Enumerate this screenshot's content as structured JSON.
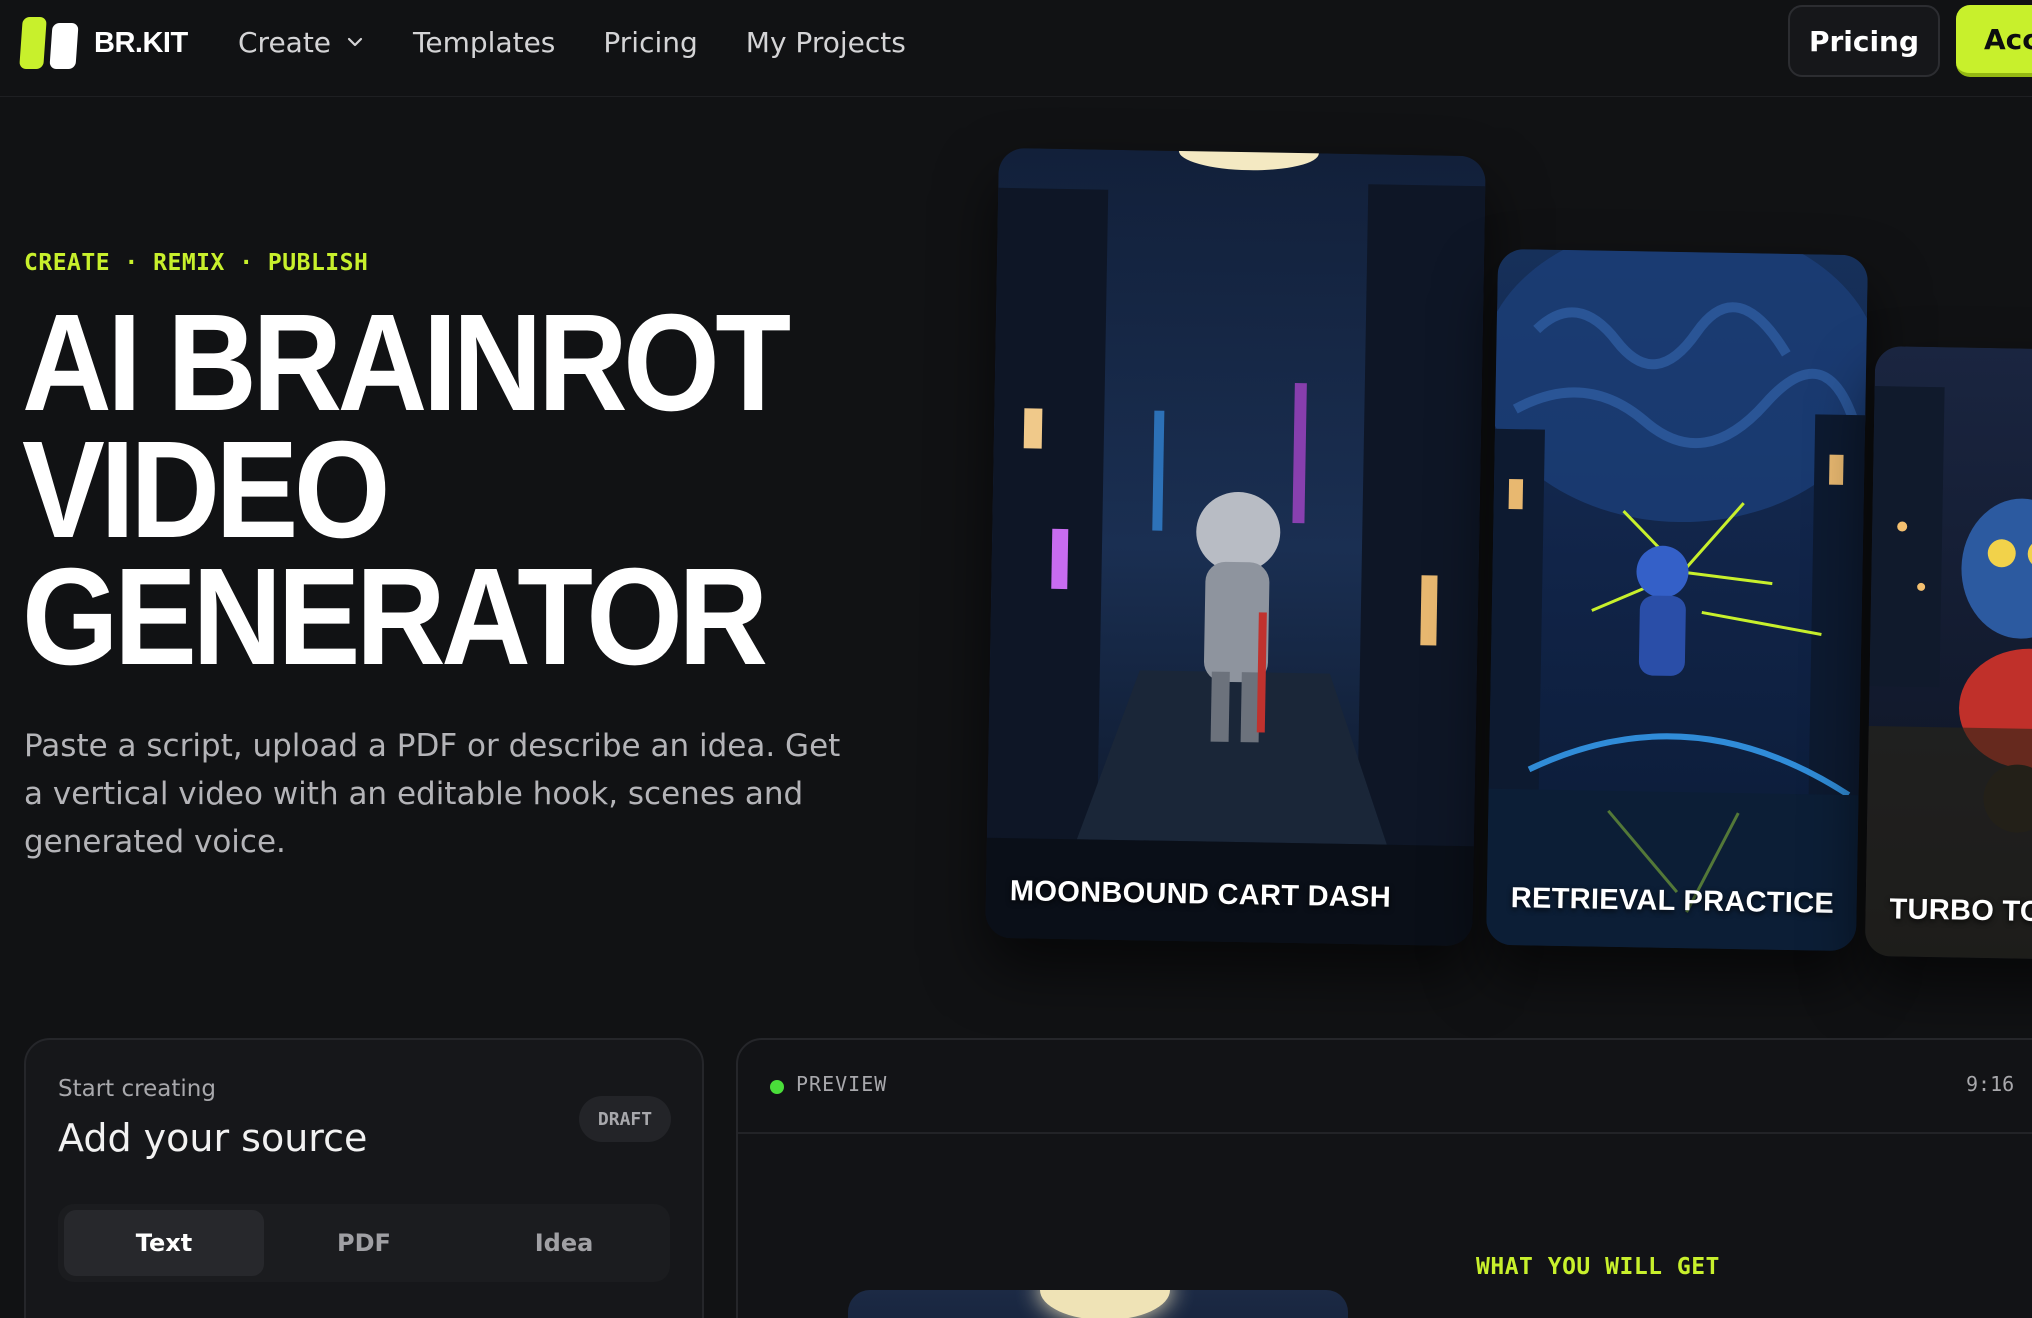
{
  "nav": {
    "logo_text": "BR.KIT",
    "links": [
      {
        "label": "Create",
        "has_dropdown": true
      },
      {
        "label": "Templates"
      },
      {
        "label": "Pricing"
      },
      {
        "label": "My Projects"
      }
    ],
    "pricing_button": "Pricing",
    "account_button": "Account"
  },
  "hero": {
    "eyebrow": "CREATE · REMIX · PUBLISH",
    "title_lines": [
      "AI BRAINROT",
      "VIDEO",
      "GENERATOR"
    ],
    "subtitle": "Paste a script, upload a PDF or describe an idea. Get a vertical video with an editable hook, scenes and generated voice."
  },
  "cards": [
    {
      "title": "MOONBOUND CART DASH"
    },
    {
      "title": "RETRIEVAL PRACTICE"
    },
    {
      "title": "TURBO TOSS"
    }
  ],
  "source_panel": {
    "kicker": "Start creating",
    "title": "Add your source",
    "badge": "DRAFT",
    "tabs": [
      {
        "label": "Text",
        "active": true
      },
      {
        "label": "PDF",
        "active": false
      },
      {
        "label": "Idea",
        "active": false
      }
    ]
  },
  "preview_panel": {
    "label": "PREVIEW",
    "aspect_ratio": "9:16",
    "section_heading": "WHAT YOU WILL GET"
  },
  "colors": {
    "accent": "#c8f02c",
    "background": "#111214",
    "panel": "#16171a",
    "status_dot": "#4ade3a"
  }
}
